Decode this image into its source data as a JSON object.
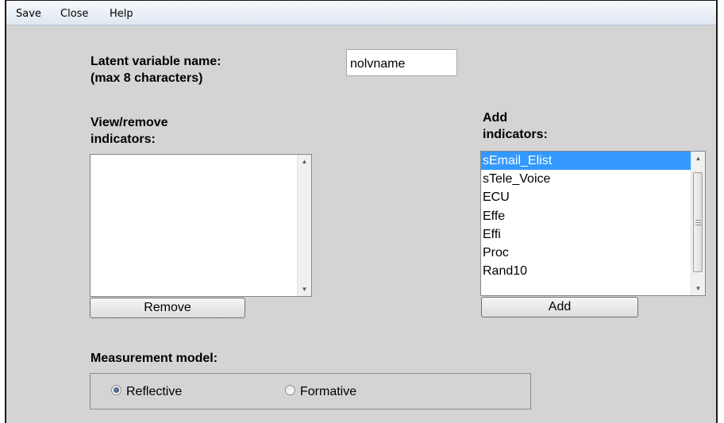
{
  "menu": {
    "items": [
      "Save",
      "Close",
      "Help"
    ]
  },
  "latent": {
    "label_line1": "Latent variable name:",
    "label_line2": "(max 8 characters)",
    "value": "nolvname"
  },
  "view_remove": {
    "label_line1": "View/remove",
    "label_line2": "indicators:",
    "items": [],
    "button": "Remove"
  },
  "add": {
    "label_line1": "Add",
    "label_line2": "indicators:",
    "items": [
      "sEmail_Elist",
      "sTele_Voice",
      "ECU",
      "Effe",
      "Effi",
      "Proc",
      "Rand10"
    ],
    "selected_index": 0,
    "button": "Add"
  },
  "measurement": {
    "label": "Measurement model:",
    "options": [
      "Reflective",
      "Formative"
    ],
    "selected": "Reflective"
  },
  "colors": {
    "selection": "#3399ff",
    "window_bg": "#d4d4d4"
  }
}
